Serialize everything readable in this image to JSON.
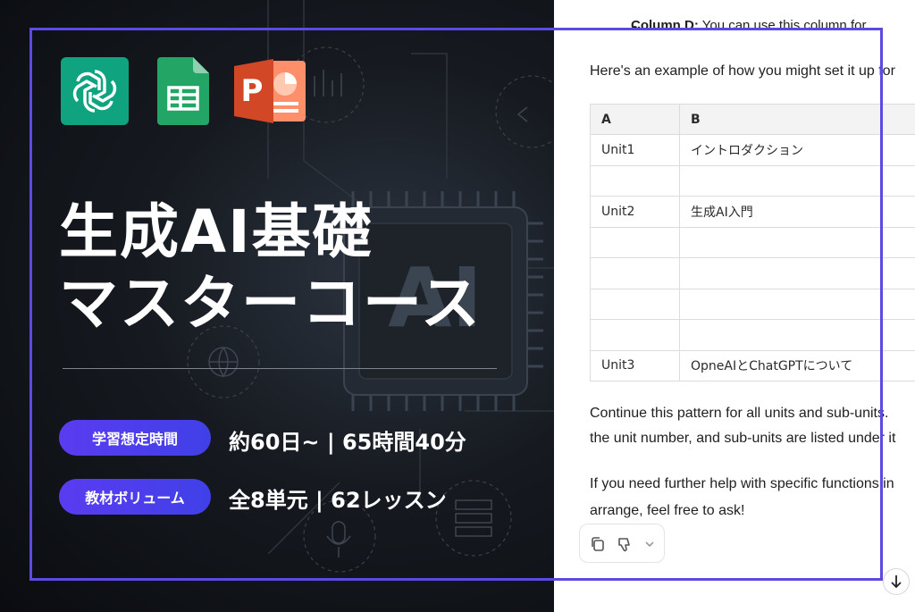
{
  "banner": {
    "title_line1": "生成AI基礎",
    "title_line2": "マスターコース",
    "chip_text": "AI",
    "app_icons": [
      "chatgpt-icon",
      "google-sheets-icon",
      "powerpoint-icon"
    ],
    "ppt_letter": "P",
    "stats": [
      {
        "label": "学習想定時間",
        "value": "約60日~ | 65時間40分"
      },
      {
        "label": "教材ボリューム",
        "value": "全8単元 | 62レッスン"
      }
    ],
    "colors": {
      "pill": "#5a3cf0",
      "frame": "#5b4be0",
      "chatgpt": "#10a37f",
      "sheets": "#23a566",
      "ppt": "#d24726"
    }
  },
  "chat": {
    "bullet_bold": "Column D:",
    "bullet_rest": " You can use this column for",
    "intro": "Here's an example of how you might set it up for",
    "table": {
      "headers": [
        "A",
        "B"
      ],
      "rows": [
        [
          "Unit1",
          "イントロダクション"
        ],
        [
          "",
          ""
        ],
        [
          "Unit2",
          "生成AI入門"
        ],
        [
          "",
          ""
        ],
        [
          "",
          ""
        ],
        [
          "",
          ""
        ],
        [
          "",
          ""
        ],
        [
          "Unit3",
          "OpneAIとChatGPTについて"
        ]
      ]
    },
    "continue_line1": "Continue this pattern for all units and sub-units.",
    "continue_line2": "the unit number, and sub-units are listed under it",
    "help_line1": "If you need further help with specific functions in",
    "help_line2": "arrange, feel free to ask!",
    "action_icons": [
      "copy-icon",
      "thumbs-down-icon",
      "chevron-down-icon"
    ],
    "scroll_icon": "arrow-down-icon"
  }
}
